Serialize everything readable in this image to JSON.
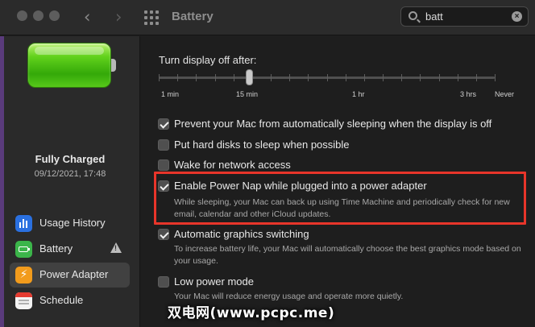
{
  "window": {
    "title": "Battery",
    "back_icon": "chevron-left-icon",
    "forward_icon": "chevron-right-icon",
    "grid_icon": "show-all-grid-icon"
  },
  "search": {
    "value": "batt",
    "icon": "search-icon",
    "clear_icon": "clear-icon"
  },
  "sidebar": {
    "status": "Fully Charged",
    "date": "09/12/2021, 17:48",
    "items": [
      {
        "label": "Usage History",
        "icon": "usage-history-icon",
        "selected": false
      },
      {
        "label": "Battery",
        "icon": "battery-icon",
        "selected": false,
        "warning": true
      },
      {
        "label": "Power Adapter",
        "icon": "power-adapter-icon",
        "selected": true
      },
      {
        "label": "Schedule",
        "icon": "schedule-icon",
        "selected": false
      }
    ]
  },
  "display_off": {
    "label": "Turn display off after:",
    "tick_labels": [
      "1 min",
      "15 min",
      "1 hr",
      "3 hrs",
      "Never"
    ],
    "value": "15 min"
  },
  "options": [
    {
      "label": "Prevent your Mac from automatically sleeping when the display is off",
      "checked": true,
      "description": ""
    },
    {
      "label": "Put hard disks to sleep when possible",
      "checked": false,
      "description": ""
    },
    {
      "label": "Wake for network access",
      "checked": false,
      "description": ""
    },
    {
      "label": "Enable Power Nap while plugged into a power adapter",
      "checked": true,
      "description": "While sleeping, your Mac can back up using Time Machine and periodically check for new email, calendar and other iCloud updates."
    },
    {
      "label": "Automatic graphics switching",
      "checked": true,
      "description": "To increase battery life, your Mac will automatically choose the best graphics mode based on your usage."
    },
    {
      "label": "Low power mode",
      "checked": false,
      "description": "Your Mac will reduce energy usage and operate more quietly."
    }
  ],
  "colors": {
    "highlight": "#e8352a",
    "accent_sidebar": "#5a3b7c"
  },
  "watermark": "双电网(www.pcpc.me)"
}
